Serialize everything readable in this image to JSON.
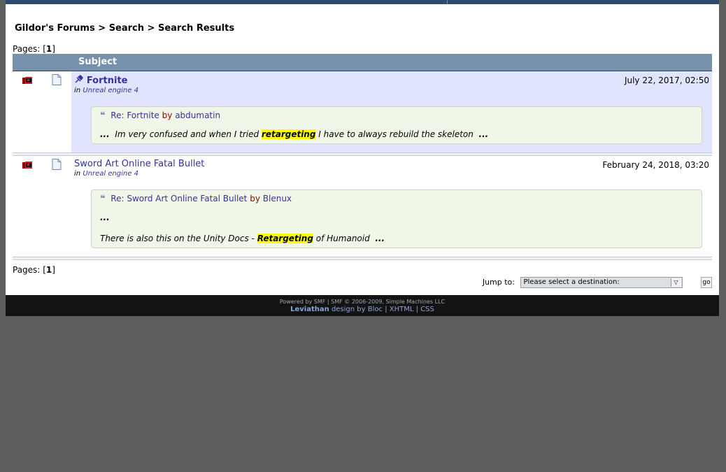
{
  "breadcrumb": {
    "item1": "Gildor's Forums",
    "sep": ">",
    "item2": "Search",
    "item3": "Search Results"
  },
  "pages": {
    "label": "Pages:",
    "open": "[",
    "current": "1",
    "close": "]"
  },
  "header": {
    "subject": "Subject"
  },
  "results": [
    {
      "title": "Fortnite",
      "board_prefix": "in",
      "board": "Unreal engine 4",
      "date": "July 22, 2017, 02:50",
      "reply_title": "Re: Fortnite",
      "by": "by",
      "author": "abdumatin",
      "ellipsis_start": "...",
      "text_before": "Im very confused and when I tried",
      "highlight": "retargeting",
      "text_after": "I have to always rebuild the skeleton",
      "ellipsis_end": "..."
    },
    {
      "title": "Sword Art Online Fatal Bullet",
      "board_prefix": "in",
      "board": "Unreal engine 4",
      "date": "February 24, 2018, 03:20",
      "reply_title": "Re: Sword Art Online Fatal Bullet",
      "by": "by",
      "author": "Blenux",
      "line1": "...",
      "text_before": "There is also this on the Unity Docs -",
      "highlight": "Retargeting",
      "text_after": "of Humanoid",
      "ellipsis_end": "..."
    }
  ],
  "jump": {
    "label": "Jump to:",
    "placeholder": "Please select a destination:",
    "go": "go"
  },
  "footer": {
    "powered": "Powered by SMF | SMF © 2006-2009, Simple Machines LLC",
    "theme": "Leviathan",
    "design_by": "design by Bloc",
    "sep": "|",
    "xhtml": "XHTML",
    "css": "CSS"
  },
  "colors": {
    "header_bg": "#7790ab",
    "highlight": "#ffff00",
    "row_bg": "#e0e4fc",
    "quote_bg": "#f0f7e8",
    "link": "#333399"
  }
}
